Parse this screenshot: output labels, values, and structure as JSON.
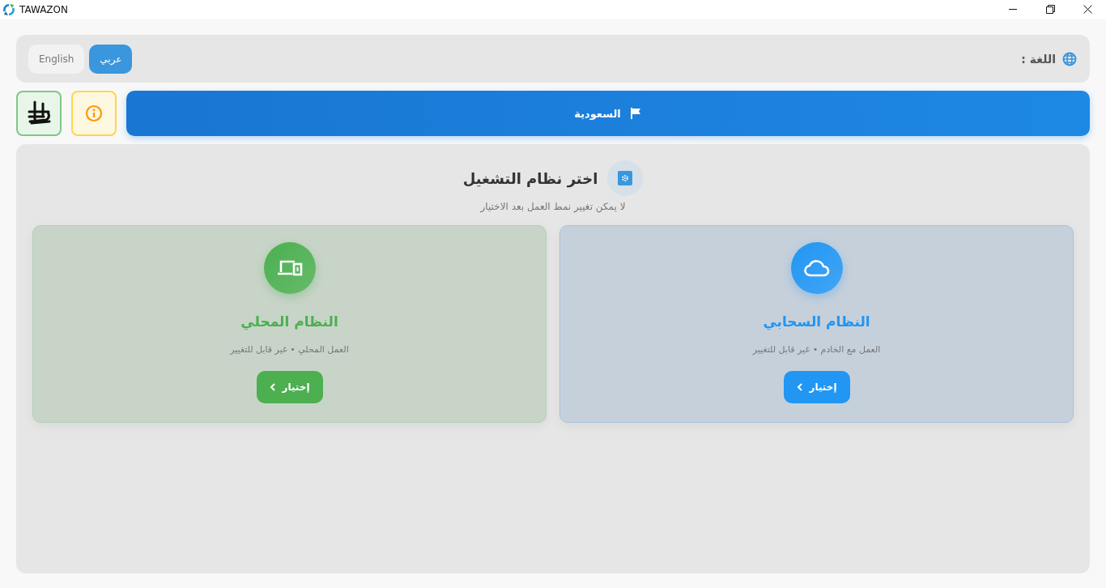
{
  "window": {
    "title": "TAWAZON"
  },
  "language_bar": {
    "label": "اللغة :",
    "options": [
      {
        "label": "عربي",
        "selected": true
      },
      {
        "label": "English",
        "selected": false
      }
    ]
  },
  "country_button": {
    "label": "السعودية"
  },
  "system_panel": {
    "title": "اختر نظام التشغيل",
    "subtitle": "لا يمكن تغيير نمط العمل بعد الاختيار",
    "options": [
      {
        "kind": "cloud",
        "title": "النظام السحابي",
        "description": "العمل مع الخادم • غير قابل للتغيير",
        "button": "إختيار"
      },
      {
        "kind": "local",
        "title": "النظام المحلي",
        "description": "العمل المحلي • غير قابل للتغيير",
        "button": "إختيار"
      }
    ]
  }
}
